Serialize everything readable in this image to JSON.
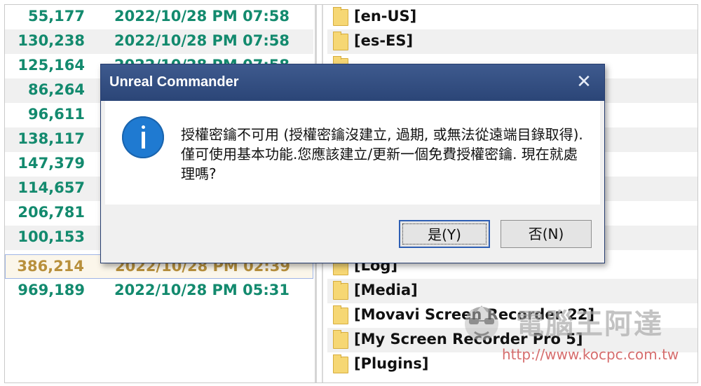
{
  "left_panel": {
    "rows": [
      {
        "size": "55,177",
        "date": "2022/10/28 PM 07:58"
      },
      {
        "size": "130,238",
        "date": "2022/10/28 PM 07:58"
      },
      {
        "size": "125,164",
        "date": "2022/10/28 PM 07:58"
      },
      {
        "size": "86,264",
        "date": ""
      },
      {
        "size": "96,611",
        "date": ""
      },
      {
        "size": "138,117",
        "date": ""
      },
      {
        "size": "147,379",
        "date": ""
      },
      {
        "size": "114,657",
        "date": ""
      },
      {
        "size": "206,781",
        "date": ""
      },
      {
        "size": "100,153",
        "date": ""
      },
      {
        "size": "386,214",
        "date": "2022/10/28 PM 02:39"
      },
      {
        "size": "969,189",
        "date": "2022/10/28 PM 05:31"
      }
    ]
  },
  "right_panel": {
    "folders": [
      {
        "name": "[en-US]"
      },
      {
        "name": "[es-ES]"
      },
      {
        "name": ""
      },
      {
        "name": ""
      },
      {
        "name": ""
      },
      {
        "name": ""
      },
      {
        "name": ""
      },
      {
        "name": ""
      },
      {
        "name": ""
      },
      {
        "name": ""
      },
      {
        "name": "[Log]"
      },
      {
        "name": "[Media]"
      },
      {
        "name": "[Movavi Screen Recorder 22]"
      },
      {
        "name": "[My Screen Recorder Pro 5]"
      },
      {
        "name": "[Plugins]"
      }
    ]
  },
  "dialog": {
    "title": "Unreal Commander",
    "close_glyph": "✕",
    "icon": "info-icon",
    "message": "授權密鑰不可用 (授權密鑰沒建立, 過期, 或無法從遠端目錄取得). 僅可使用基本功能.您應該建立/更新一個免費授權密鑰. 現在就處理嗎?",
    "yes_label": "是(Y)",
    "no_label": "否(N)"
  },
  "watermark": {
    "text": "電腦王阿達",
    "url": "http://www.kocpc.com.tw"
  },
  "colors": {
    "size_text": "#138a6e",
    "titlebar": "#2b4577",
    "info_icon": "#1f7ad1",
    "folder": "#f6d774"
  }
}
